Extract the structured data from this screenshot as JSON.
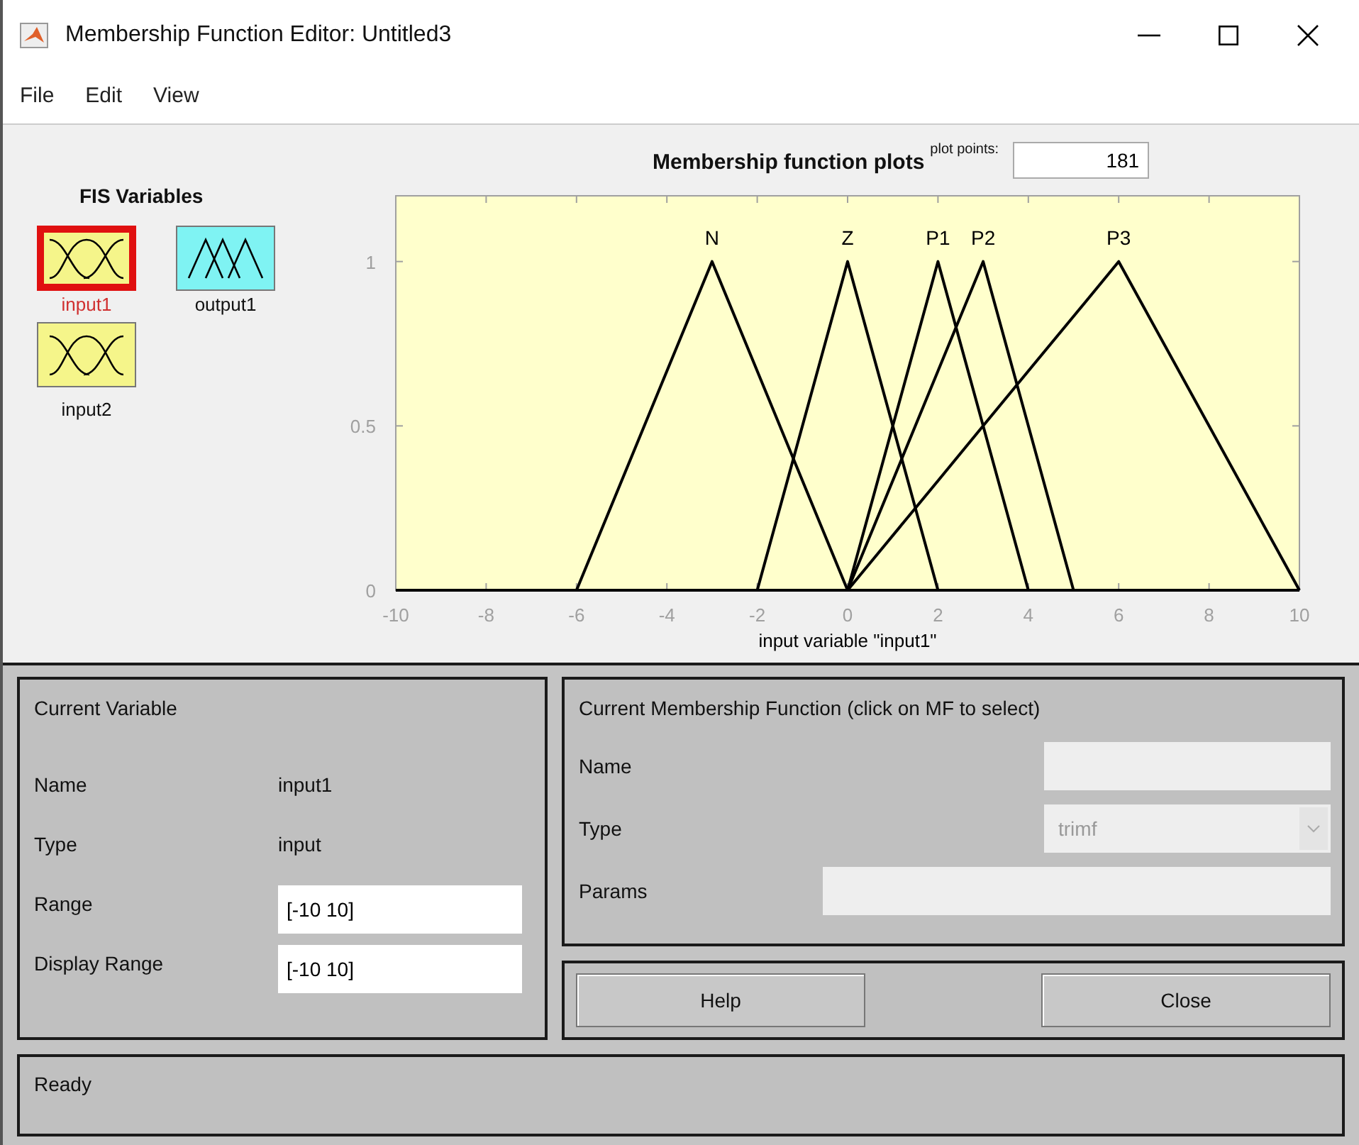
{
  "window": {
    "title": "Membership Function Editor: Untitled3"
  },
  "menu": [
    "File",
    "Edit",
    "View"
  ],
  "fis_variables": {
    "title": "FIS Variables",
    "items": [
      {
        "label": "input1",
        "kind": "input",
        "selected": true
      },
      {
        "label": "output1",
        "kind": "output",
        "selected": false
      },
      {
        "label": "input2",
        "kind": "input",
        "selected": false
      }
    ]
  },
  "plot_points": {
    "label": "plot points:",
    "value": "181"
  },
  "chart_data": {
    "type": "line",
    "title": "Membership function plots",
    "xlabel": "input variable \"input1\"",
    "x": [
      -10,
      -6,
      -3,
      -2,
      0,
      2,
      3,
      4,
      5,
      6,
      10
    ],
    "series": [
      {
        "name": "N",
        "color": "#000000",
        "values": [
          0,
          0,
          1,
          0.667,
          0,
          0,
          0,
          0,
          0,
          0,
          0
        ]
      },
      {
        "name": "Z",
        "color": "#000000",
        "values": [
          0,
          0,
          0,
          0,
          1,
          0,
          0,
          0,
          0,
          0,
          0
        ]
      },
      {
        "name": "P1",
        "color": "#000000",
        "values": [
          0,
          0,
          0,
          0,
          0,
          1,
          0.5,
          0,
          0,
          0,
          0
        ]
      },
      {
        "name": "P2",
        "color": "#000000",
        "values": [
          0,
          0,
          0,
          0,
          0,
          0.667,
          1,
          0.5,
          0,
          0,
          0
        ]
      },
      {
        "name": "P3",
        "color": "#000000",
        "values": [
          0,
          0,
          0,
          0,
          0,
          0.333,
          0.5,
          0.667,
          0.833,
          1,
          0
        ]
      }
    ],
    "xlim": [
      -10,
      10
    ],
    "ylim": [
      0,
      1.2
    ],
    "xticks": [
      -10,
      -8,
      -6,
      -4,
      -2,
      0,
      2,
      4,
      6,
      8,
      10
    ],
    "yticks": [
      0,
      0.5,
      1
    ]
  },
  "current_variable": {
    "title": "Current Variable",
    "rows": [
      {
        "label": "Name",
        "value": "input1",
        "kind": "text"
      },
      {
        "label": "Type",
        "value": "input",
        "kind": "text"
      },
      {
        "label": "Range",
        "value": "[-10 10]",
        "kind": "field"
      },
      {
        "label": "Display Range",
        "value": "[-10 10]",
        "kind": "field"
      }
    ]
  },
  "current_mf": {
    "title": "Current Membership Function (click on MF to select)",
    "name_label": "Name",
    "type_label": "Type",
    "type_value": "trimf",
    "params_label": "Params",
    "disabled": true
  },
  "buttons": [
    "Help",
    "Close"
  ],
  "status": "Ready"
}
